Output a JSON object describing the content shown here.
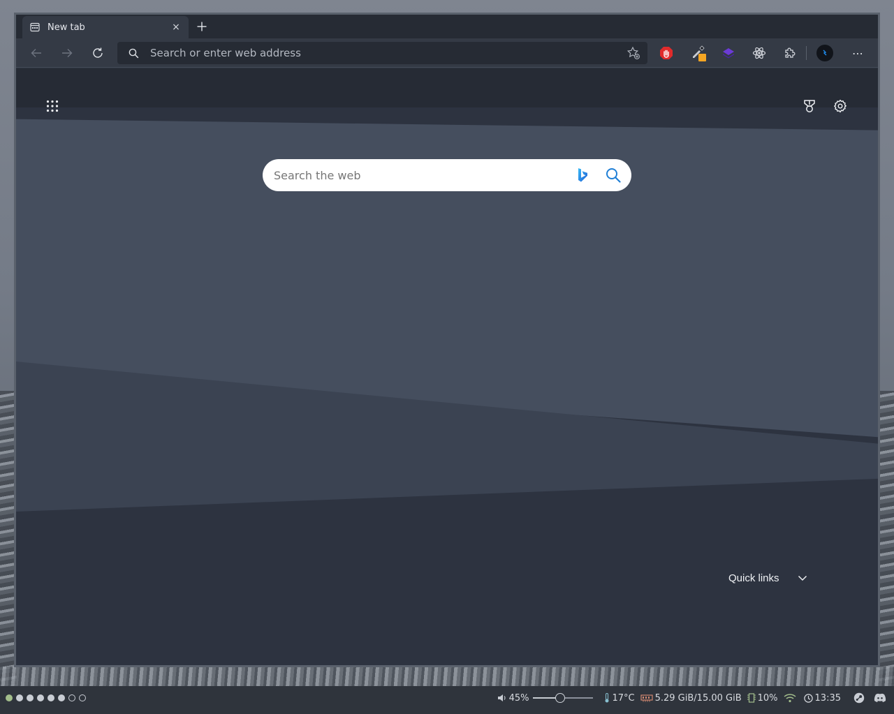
{
  "browser": {
    "tab": {
      "title": "New tab",
      "close": "×"
    },
    "new_tab": "+",
    "address": {
      "placeholder": "Search or enter web address",
      "value": ""
    },
    "extensions": [
      "stop-hand-icon",
      "eyedropper-icon",
      "layers-icon",
      "atom-icon",
      "puzzle-icon",
      "profile-icon"
    ],
    "more": "⋯"
  },
  "newtab_page": {
    "search": {
      "placeholder": "Search the web",
      "value": ""
    },
    "quick_links": {
      "label": "Quick links"
    }
  },
  "taskbar": {
    "workspaces": {
      "active": 1,
      "occupied": 5,
      "empty": 2
    },
    "volume": {
      "label": "45%",
      "level": 0.45
    },
    "temperature": "17°C",
    "memory": "5.29 GiB/15.00 GiB",
    "cpu": "10%",
    "clock": "13:35"
  },
  "colors": {
    "accent_green": "#a3be8c",
    "bing_blue": "#1f7fd6",
    "page_bg": "#2d3340"
  }
}
